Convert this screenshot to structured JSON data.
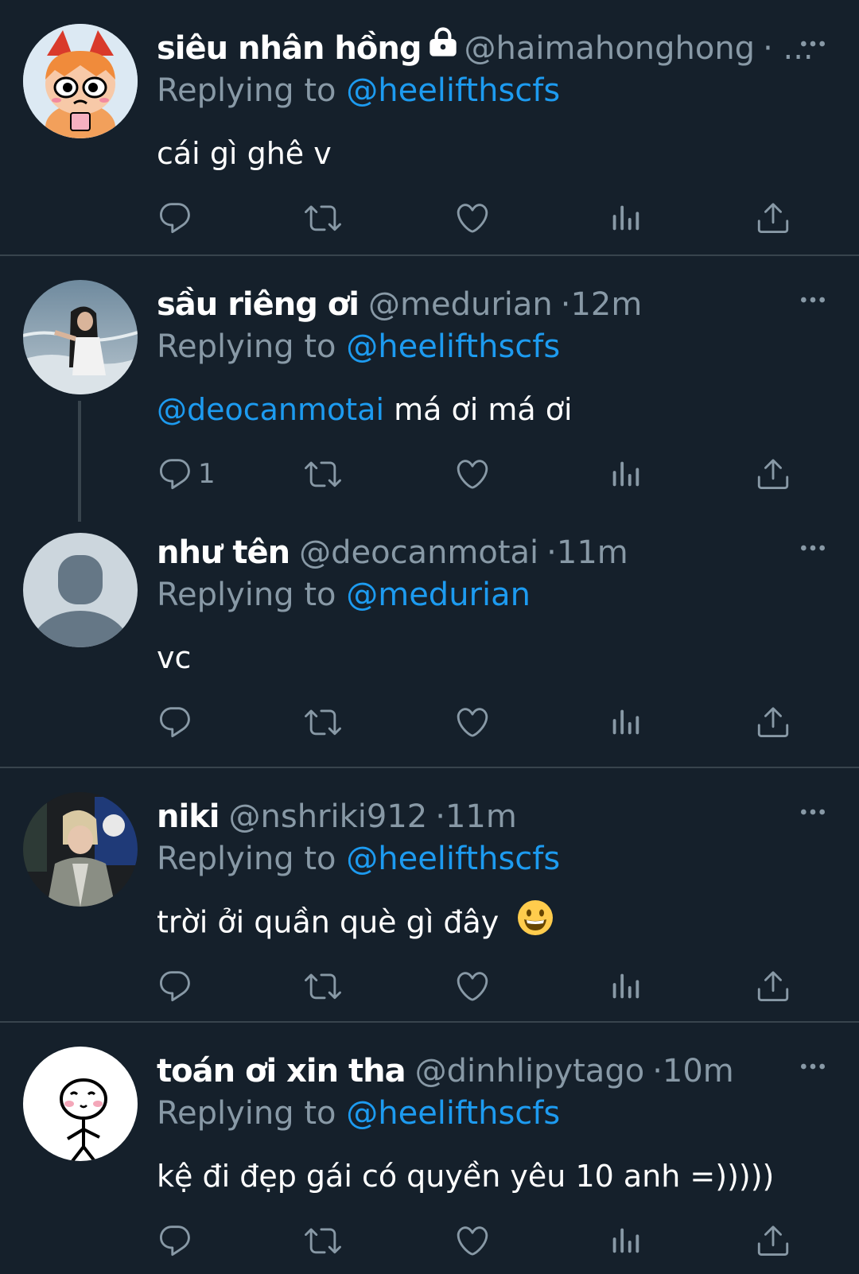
{
  "replies": [
    {
      "display_name": "siêu nhân hồng",
      "handle": "@haimahonghong",
      "timestamp": "· ...",
      "replying_prefix": "Replying to",
      "replying_to": "@heelifthscfs",
      "text": "cái gì ghê v",
      "reply_count": "",
      "locked": true
    },
    {
      "display_name": "sầu riêng ơi",
      "handle": "@medurian",
      "timestamp": "12m",
      "replying_prefix": "Replying to",
      "replying_to": "@heelifthscfs",
      "mention": "@deocanmotai",
      "text": "má ơi má ơi",
      "reply_count": "1"
    },
    {
      "display_name": "như tên",
      "handle": "@deocanmotai",
      "timestamp": "11m",
      "replying_prefix": "Replying to",
      "replying_to": "@medurian",
      "text": "vc",
      "reply_count": ""
    },
    {
      "display_name": "niki",
      "handle": "@nshriki912",
      "timestamp": "11m",
      "replying_prefix": "Replying to",
      "replying_to": "@heelifthscfs",
      "text": "trời ởi quần què gì đây",
      "reply_count": ""
    },
    {
      "display_name": "toán ơi xin tha",
      "handle": "@dinhlipytago",
      "timestamp": "10m",
      "replying_prefix": "Replying to",
      "replying_to": "@heelifthscfs",
      "text": "kệ đi đẹp gái có quyền yêu 10 anh =)))))",
      "reply_count": ""
    }
  ],
  "colors": {
    "background": "#15202b",
    "divider": "#38444d",
    "muted": "#8899a6",
    "link": "#1d9bf0"
  },
  "icons": [
    "reply-icon",
    "retweet-icon",
    "like-icon",
    "analytics-icon",
    "share-icon",
    "more-icon",
    "lock-icon",
    "grinning-emoji"
  ]
}
